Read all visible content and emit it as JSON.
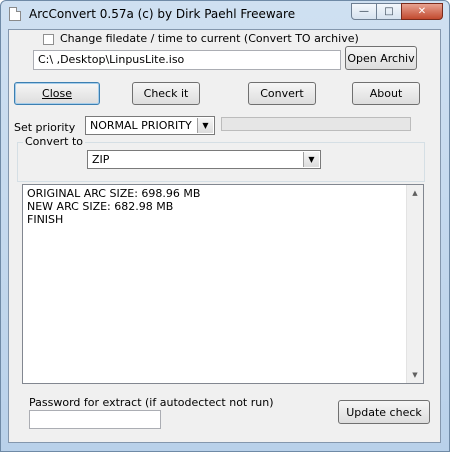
{
  "window": {
    "title": "ArcConvert 0.57a (c) by Dirk Paehl Freeware",
    "min_glyph": "—",
    "max_glyph": "□",
    "close_glyph": "✕"
  },
  "options": {
    "change_filedate_label": "Change filedate / time to current (Convert TO archive)",
    "change_filedate_checked": false
  },
  "file": {
    "path": "C:\\               ,Desktop\\LinpusLite.iso",
    "open_button": "Open Archiv"
  },
  "actions": {
    "close": "Close",
    "check": "Check it",
    "convert": "Convert",
    "about": "About"
  },
  "priority": {
    "label": "Set priority",
    "value": "NORMAL PRIORITY",
    "progress_percent": 0
  },
  "convert_to": {
    "label": "Convert to",
    "value": "ZIP"
  },
  "log": {
    "lines": [
      "ORIGINAL ARC SIZE: 698.96 MB",
      "NEW ARC SIZE: 682.98 MB",
      "FINISH"
    ]
  },
  "password": {
    "label": "Password for extract (if autodectect not run)",
    "value": ""
  },
  "update_button": "Update check"
}
